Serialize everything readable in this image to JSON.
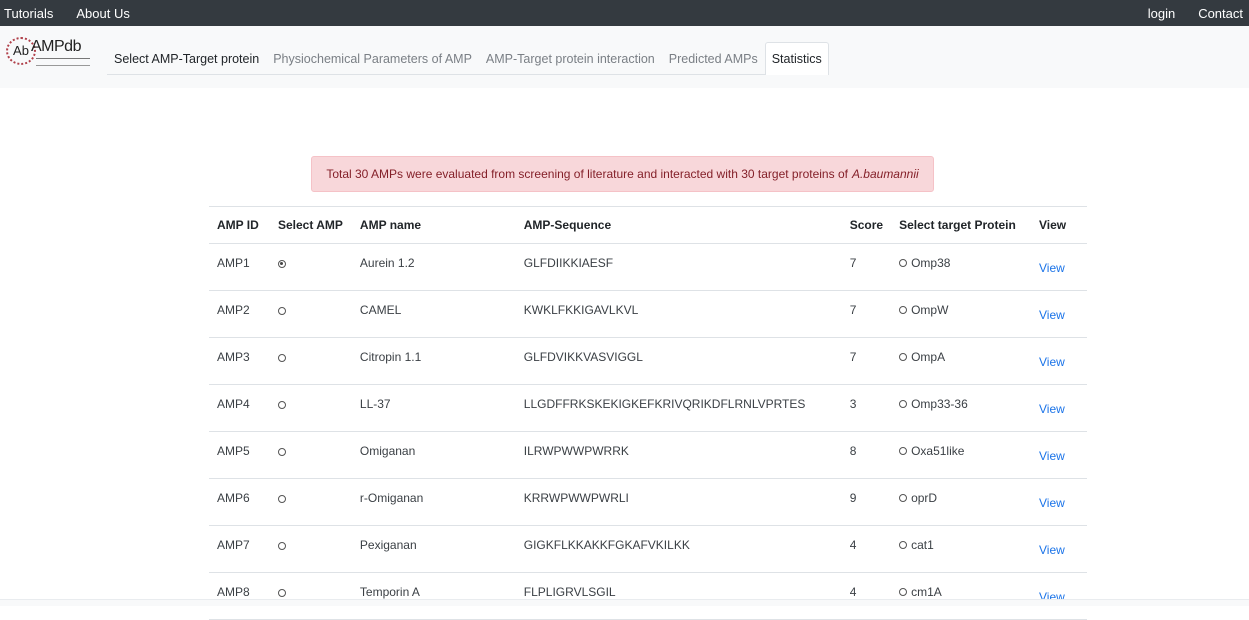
{
  "topnav": {
    "left": [
      "Tutorials",
      "About Us"
    ],
    "right": [
      "login",
      "Contact"
    ]
  },
  "logo": {
    "ab": "Ab",
    "amp": "AMPdb"
  },
  "tabs": [
    {
      "label": "Select AMP-Target protein",
      "state": "dark"
    },
    {
      "label": "Physiochemical Parameters of AMP",
      "state": "muted"
    },
    {
      "label": "AMP-Target protein interaction",
      "state": "muted"
    },
    {
      "label": "Predicted AMPs",
      "state": "muted"
    },
    {
      "label": "Statistics",
      "state": "active"
    }
  ],
  "alert": {
    "text": "Total 30 AMPs were evaluated from screening of literature and interacted with 30 target proteins of",
    "organism": "A.baumannii"
  },
  "table": {
    "headers": [
      "AMP ID",
      "Select AMP",
      "AMP name",
      "AMP-Sequence",
      "Score",
      "Select target Protein",
      "View"
    ],
    "rows": [
      {
        "id": "AMP1",
        "selected": true,
        "name": "Aurein 1.2",
        "seq": "GLFDIIKKIAESF",
        "score": "7",
        "target": "Omp38",
        "view": "View"
      },
      {
        "id": "AMP2",
        "selected": false,
        "name": "CAMEL",
        "seq": "KWKLFKKIGAVLKVL",
        "score": "7",
        "target": "OmpW",
        "view": "View"
      },
      {
        "id": "AMP3",
        "selected": false,
        "name": "Citropin 1.1",
        "seq": "GLFDVIKKVASVIGGL",
        "score": "7",
        "target": "OmpA",
        "view": "View"
      },
      {
        "id": "AMP4",
        "selected": false,
        "name": "LL-37",
        "seq": "LLGDFFRKSKEKIGKEFKRIVQRIKDFLRNLVPRTES",
        "score": "3",
        "target": "Omp33-36",
        "view": "View"
      },
      {
        "id": "AMP5",
        "selected": false,
        "name": "Omiganan",
        "seq": "ILRWPWWPWRRK",
        "score": "8",
        "target": "Oxa51like",
        "view": "View"
      },
      {
        "id": "AMP6",
        "selected": false,
        "name": "r-Omiganan",
        "seq": "KRRWPWWPWRLI",
        "score": "9",
        "target": "oprD",
        "view": "View"
      },
      {
        "id": "AMP7",
        "selected": false,
        "name": "Pexiganan",
        "seq": "GIGKFLKKAKKFGKAFVKILKK",
        "score": "4",
        "target": "cat1",
        "view": "View"
      },
      {
        "id": "AMP8",
        "selected": false,
        "name": "Temporin A",
        "seq": "FLPLIGRVLSGIL",
        "score": "4",
        "target": "cm1A",
        "view": "View"
      }
    ]
  }
}
